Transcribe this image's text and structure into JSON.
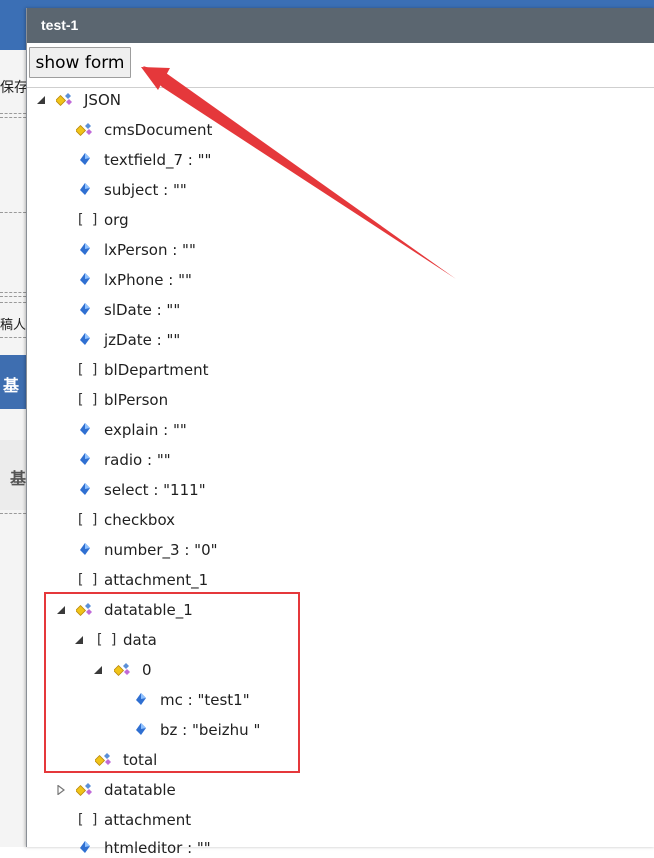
{
  "background": {
    "fragments": [
      "保存",
      "稿人",
      "基",
      "基"
    ]
  },
  "dialog": {
    "title": "test-1",
    "show_form_label": "show form"
  },
  "tree": {
    "root": {
      "label": "JSON"
    },
    "items": [
      {
        "label": "cmsDocument",
        "icon": "object-icon"
      },
      {
        "label": "textfield_7 : \"\"",
        "icon": "value-icon"
      },
      {
        "label": "subject : \"\"",
        "icon": "value-icon"
      },
      {
        "label": "org",
        "icon": "array-icon"
      },
      {
        "label": "lxPerson : \"\"",
        "icon": "value-icon"
      },
      {
        "label": "lxPhone : \"\"",
        "icon": "value-icon"
      },
      {
        "label": "slDate : \"\"",
        "icon": "value-icon"
      },
      {
        "label": "jzDate : \"\"",
        "icon": "value-icon"
      },
      {
        "label": "blDepartment",
        "icon": "array-icon"
      },
      {
        "label": "blPerson",
        "icon": "array-icon"
      },
      {
        "label": "explain : \"\"",
        "icon": "value-icon"
      },
      {
        "label": "radio : \"\"",
        "icon": "value-icon"
      },
      {
        "label": "select : \"111\"",
        "icon": "value-icon"
      },
      {
        "label": "checkbox",
        "icon": "array-icon"
      },
      {
        "label": "number_3 : \"0\"",
        "icon": "value-icon"
      },
      {
        "label": "attachment_1",
        "icon": "array-icon"
      },
      {
        "label": "datatable_1",
        "icon": "object-icon"
      },
      {
        "label": "data",
        "icon": "array-icon"
      },
      {
        "label": "0",
        "icon": "object-icon"
      },
      {
        "label": "mc : \"test1\"",
        "icon": "value-icon"
      },
      {
        "label": "bz : \"beizhu \"",
        "icon": "value-icon"
      },
      {
        "label": "total",
        "icon": "object-icon"
      },
      {
        "label": "datatable",
        "icon": "object-icon"
      },
      {
        "label": "attachment",
        "icon": "array-icon"
      },
      {
        "label": "htmleditor : \"\"",
        "icon": "value-icon"
      }
    ],
    "array_glyph": "[ ]"
  },
  "colors": {
    "titlebar": "#5b6670",
    "annotation_red": "#e5383b",
    "background_blue": "#3b6fb5"
  }
}
